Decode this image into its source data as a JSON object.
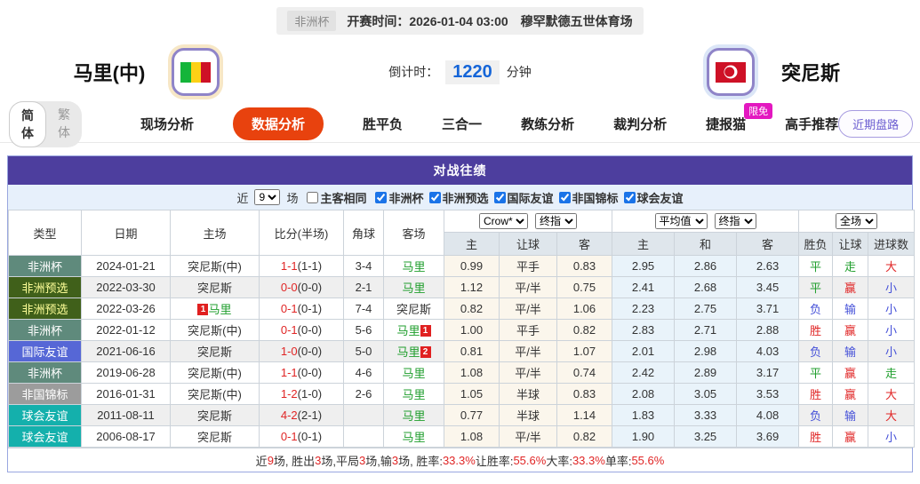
{
  "topbar": {
    "league": "非洲杯",
    "kickoff": "开赛时间：2026-01-04 03:00",
    "venue": "穆罕默德五世体育场"
  },
  "teams": {
    "home": {
      "name": "马里(中)",
      "flag": "mali"
    },
    "away": {
      "name": "突尼斯",
      "flag": "tunisia"
    },
    "countdown": {
      "label": "倒计时：",
      "value": "1220",
      "unit": "分钟"
    }
  },
  "lang_toggle": {
    "options": [
      "简体",
      "繁体"
    ],
    "selected": "简体"
  },
  "nav": {
    "items": [
      {
        "label": "现场分析",
        "active": false
      },
      {
        "label": "数据分析",
        "active": true
      },
      {
        "label": "胜平负",
        "active": false
      },
      {
        "label": "三合一",
        "active": false
      },
      {
        "label": "教练分析",
        "active": false
      },
      {
        "label": "裁判分析",
        "active": false
      },
      {
        "label": "捷报猫",
        "active": false,
        "badge": "限免"
      },
      {
        "label": "高手推荐",
        "active": false
      }
    ],
    "right_button": "近期盘路"
  },
  "panel": {
    "title": "对战往绩"
  },
  "filters": {
    "prefix": "近",
    "match_count": "9",
    "suffix": "场",
    "same_venue_label": "主客相同",
    "same_venue_checked": false,
    "leagues": [
      {
        "label": "非洲杯",
        "checked": true
      },
      {
        "label": "非洲预选",
        "checked": true
      },
      {
        "label": "国际友谊",
        "checked": true
      },
      {
        "label": "非国锦标",
        "checked": true
      },
      {
        "label": "球会友谊",
        "checked": true
      }
    ]
  },
  "table": {
    "main_headers": [
      "类型",
      "日期",
      "主场",
      "比分(半场)",
      "角球",
      "客场"
    ],
    "sub_headers": [
      "主",
      "让球",
      "客",
      "主",
      "和",
      "客",
      "胜负",
      "让球",
      "进球数"
    ],
    "selects": {
      "odds_company": "Crow*",
      "odds_stage": "终指",
      "europe_type": "平均值",
      "europe_stage": "终指",
      "scope": "全场"
    },
    "type_colors": {
      "cup": {
        "bg": "#5f8a7c",
        "fg": "#ffffff"
      },
      "pre": {
        "bg": "#40601a",
        "fg": "#ffff99"
      },
      "intl": {
        "bg": "#5667d6",
        "fg": "#ffffff"
      },
      "nchamp": {
        "bg": "#9c9c9c",
        "fg": "#ffffff"
      },
      "club": {
        "bg": "#14b0ac",
        "fg": "#ffffff"
      }
    },
    "rows": [
      {
        "type": "非洲杯",
        "type_class": "cup",
        "date": "2024-01-21",
        "home": {
          "name": "突尼斯(中)",
          "color": "dark",
          "badge": ""
        },
        "score": {
          "full": "1-1",
          "half": "(1-1)"
        },
        "corner": "3-4",
        "away": {
          "name": "马里",
          "color": "green",
          "badge": ""
        },
        "handicap": [
          "0.99",
          "平手",
          "0.83"
        ],
        "europe": [
          "2.95",
          "2.86",
          "2.63"
        ],
        "results": [
          {
            "text": "平",
            "color": "green"
          },
          {
            "text": "走",
            "color": "green"
          },
          {
            "text": "大",
            "color": "red"
          }
        ]
      },
      {
        "type": "非洲预选",
        "type_class": "pre",
        "date": "2022-03-30",
        "home": {
          "name": "突尼斯",
          "color": "dark",
          "badge": ""
        },
        "score": {
          "full": "0-0",
          "half": "(0-0)"
        },
        "corner": "2-1",
        "away": {
          "name": "马里",
          "color": "green",
          "badge": ""
        },
        "handicap": [
          "1.12",
          "平/半",
          "0.75"
        ],
        "europe": [
          "2.41",
          "2.68",
          "3.45"
        ],
        "results": [
          {
            "text": "平",
            "color": "green"
          },
          {
            "text": "赢",
            "color": "red"
          },
          {
            "text": "小",
            "color": "blue"
          }
        ]
      },
      {
        "type": "非洲预选",
        "type_class": "pre",
        "date": "2022-03-26",
        "home": {
          "name": "马里",
          "color": "green",
          "badge": "1"
        },
        "score": {
          "full": "0-1",
          "half": "(0-1)"
        },
        "corner": "7-4",
        "away": {
          "name": "突尼斯",
          "color": "dark",
          "badge": ""
        },
        "handicap": [
          "0.82",
          "平/半",
          "1.06"
        ],
        "europe": [
          "2.23",
          "2.75",
          "3.71"
        ],
        "results": [
          {
            "text": "负",
            "color": "blue"
          },
          {
            "text": "输",
            "color": "blue"
          },
          {
            "text": "小",
            "color": "blue"
          }
        ]
      },
      {
        "type": "非洲杯",
        "type_class": "cup",
        "date": "2022-01-12",
        "home": {
          "name": "突尼斯(中)",
          "color": "dark",
          "badge": ""
        },
        "score": {
          "full": "0-1",
          "half": "(0-0)"
        },
        "corner": "5-6",
        "away": {
          "name": "马里",
          "color": "green",
          "badge": "1"
        },
        "handicap": [
          "1.00",
          "平手",
          "0.82"
        ],
        "europe": [
          "2.83",
          "2.71",
          "2.88"
        ],
        "results": [
          {
            "text": "胜",
            "color": "red"
          },
          {
            "text": "赢",
            "color": "red"
          },
          {
            "text": "小",
            "color": "blue"
          }
        ]
      },
      {
        "type": "国际友谊",
        "type_class": "intl",
        "date": "2021-06-16",
        "home": {
          "name": "突尼斯",
          "color": "dark",
          "badge": ""
        },
        "score": {
          "full": "1-0",
          "half": "(0-0)"
        },
        "corner": "5-0",
        "away": {
          "name": "马里",
          "color": "green",
          "badge": "2"
        },
        "handicap": [
          "0.81",
          "平/半",
          "1.07"
        ],
        "europe": [
          "2.01",
          "2.98",
          "4.03"
        ],
        "results": [
          {
            "text": "负",
            "color": "blue"
          },
          {
            "text": "输",
            "color": "blue"
          },
          {
            "text": "小",
            "color": "blue"
          }
        ]
      },
      {
        "type": "非洲杯",
        "type_class": "cup",
        "date": "2019-06-28",
        "home": {
          "name": "突尼斯(中)",
          "color": "dark",
          "badge": ""
        },
        "score": {
          "full": "1-1",
          "half": "(0-0)"
        },
        "corner": "4-6",
        "away": {
          "name": "马里",
          "color": "green",
          "badge": ""
        },
        "handicap": [
          "1.08",
          "平/半",
          "0.74"
        ],
        "europe": [
          "2.42",
          "2.89",
          "3.17"
        ],
        "results": [
          {
            "text": "平",
            "color": "green"
          },
          {
            "text": "赢",
            "color": "red"
          },
          {
            "text": "走",
            "color": "green"
          }
        ]
      },
      {
        "type": "非国锦标",
        "type_class": "nchamp",
        "date": "2016-01-31",
        "home": {
          "name": "突尼斯(中)",
          "color": "dark",
          "badge": ""
        },
        "score": {
          "full": "1-2",
          "half": "(1-0)"
        },
        "corner": "2-6",
        "away": {
          "name": "马里",
          "color": "green",
          "badge": ""
        },
        "handicap": [
          "1.05",
          "半球",
          "0.83"
        ],
        "europe": [
          "2.08",
          "3.05",
          "3.53"
        ],
        "results": [
          {
            "text": "胜",
            "color": "red"
          },
          {
            "text": "赢",
            "color": "red"
          },
          {
            "text": "大",
            "color": "red"
          }
        ]
      },
      {
        "type": "球会友谊",
        "type_class": "club",
        "date": "2011-08-11",
        "home": {
          "name": "突尼斯",
          "color": "dark",
          "badge": ""
        },
        "score": {
          "full": "4-2",
          "half": "(2-1)"
        },
        "corner": "",
        "away": {
          "name": "马里",
          "color": "green",
          "badge": ""
        },
        "handicap": [
          "0.77",
          "半球",
          "1.14"
        ],
        "europe": [
          "1.83",
          "3.33",
          "4.08"
        ],
        "results": [
          {
            "text": "负",
            "color": "blue"
          },
          {
            "text": "输",
            "color": "blue"
          },
          {
            "text": "大",
            "color": "red"
          }
        ]
      },
      {
        "type": "球会友谊",
        "type_class": "club",
        "date": "2006-08-17",
        "home": {
          "name": "突尼斯",
          "color": "dark",
          "badge": ""
        },
        "score": {
          "full": "0-1",
          "half": "(0-1)"
        },
        "corner": "",
        "away": {
          "name": "马里",
          "color": "green",
          "badge": ""
        },
        "handicap": [
          "1.08",
          "平/半",
          "0.82"
        ],
        "europe": [
          "1.90",
          "3.25",
          "3.69"
        ],
        "results": [
          {
            "text": "胜",
            "color": "red"
          },
          {
            "text": "赢",
            "color": "red"
          },
          {
            "text": "小",
            "color": "blue"
          }
        ]
      }
    ],
    "stripe_rows": [
      1,
      4,
      7
    ]
  },
  "summary": {
    "parts": [
      {
        "text": "近 ",
        "red": false
      },
      {
        "text": "9",
        "red": true
      },
      {
        "text": " 场, 胜出 ",
        "red": false
      },
      {
        "text": "3",
        "red": true
      },
      {
        "text": " 场,平局 ",
        "red": false
      },
      {
        "text": "3",
        "red": true
      },
      {
        "text": " 场,输 ",
        "red": false
      },
      {
        "text": "3",
        "red": true
      },
      {
        "text": " 场, 胜率: ",
        "red": false
      },
      {
        "text": "33.3%",
        "red": true
      },
      {
        "text": " 让胜率: ",
        "red": false
      },
      {
        "text": "55.6%",
        "red": true
      },
      {
        "text": " 大率: ",
        "red": false
      },
      {
        "text": "33.3%",
        "red": true
      },
      {
        "text": " 单率: ",
        "red": false
      },
      {
        "text": "55.6%",
        "red": true
      }
    ]
  }
}
